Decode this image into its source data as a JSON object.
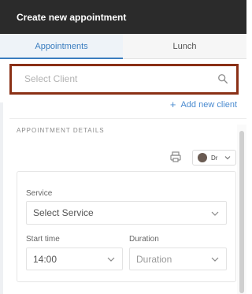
{
  "header": {
    "title": "Create new appointment"
  },
  "tabs": [
    {
      "label": "Appointments",
      "active": true
    },
    {
      "label": "Lunch",
      "active": false
    }
  ],
  "client_search": {
    "placeholder": "Select Client"
  },
  "add_client": {
    "label": "Add new client"
  },
  "section": {
    "title": "APPOINTMENT DETAILS"
  },
  "doctor_select": {
    "value": "Dr"
  },
  "form": {
    "service": {
      "label": "Service",
      "value": "Select Service"
    },
    "start_time": {
      "label": "Start time",
      "value": "14:00"
    },
    "duration": {
      "label": "Duration",
      "value": "Duration"
    }
  },
  "colors": {
    "accent": "#3a7dbf",
    "header_bg": "#2b2b2b",
    "focus_border": "#8a3016"
  }
}
